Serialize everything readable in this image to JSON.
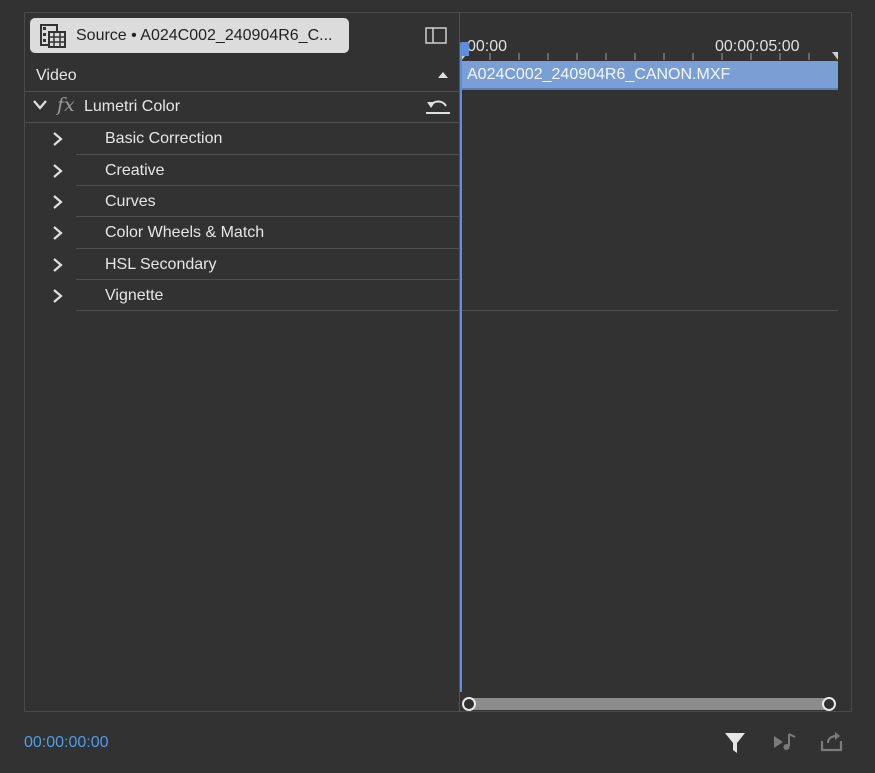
{
  "header": {
    "source_label": "Source • A024C002_240904R6_C...",
    "clip_icon": "clip-film-icon",
    "panel_icon": "panel-toggle-icon"
  },
  "effects": {
    "video_label": "Video",
    "lumetri_label": "Lumetri Color",
    "fx_label": "fx",
    "sections": [
      {
        "label": "Basic Correction"
      },
      {
        "label": "Creative"
      },
      {
        "label": "Curves"
      },
      {
        "label": "Color Wheels & Match"
      },
      {
        "label": "HSL Secondary"
      },
      {
        "label": "Vignette"
      }
    ]
  },
  "timeline": {
    "ruler_start": "00:00",
    "ruler_mid": "00:00:05:00",
    "clip_name": "A024C002_240904R6_CANON.MXF",
    "clip_color": "#7a9fd4",
    "playhead_color": "#5f8fd8"
  },
  "footer": {
    "timecode": "00:00:00:00",
    "timecode_color": "#4d9de8",
    "filter_icon": "filter-icon",
    "audio_icon": "play-audio-icon",
    "export_icon": "export-icon"
  }
}
